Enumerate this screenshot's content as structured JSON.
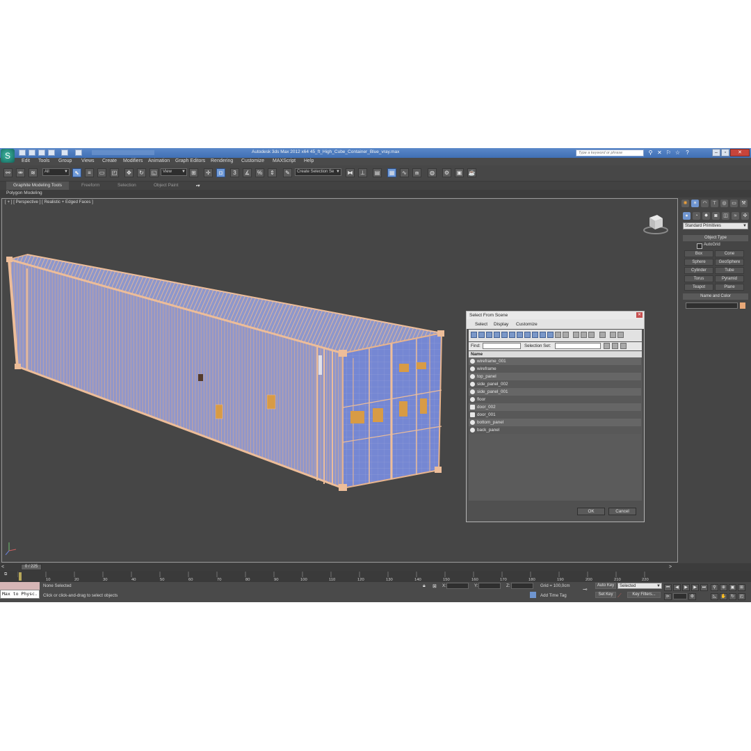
{
  "app": {
    "title": "Autodesk 3ds Max  2012 x64      45_ft_High_Cube_Container_Blue_vray.max",
    "search_placeholder": "Type a keyword or phrase"
  },
  "menu": [
    "Edit",
    "Tools",
    "Group",
    "Views",
    "Create",
    "Modifiers",
    "Animation",
    "Graph Editors",
    "Rendering",
    "Customize",
    "MAXScript",
    "Help"
  ],
  "toolbar": {
    "selection_filter": "All",
    "reference_coord": "View",
    "named_selection": "Create Selection Se"
  },
  "ribbon": {
    "tabs": [
      "Graphite Modeling Tools",
      "Freeform",
      "Selection",
      "Object Paint"
    ],
    "active_tab": "Graphite Modeling Tools",
    "subpanel": "Polygon Modeling"
  },
  "viewport": {
    "label": "[ + ] [ Perspective ] [ Realistic + Edged Faces ]"
  },
  "command_panel": {
    "category": "Standard Primitives",
    "object_type_title": "Object Type",
    "autogrid": "AutoGrid",
    "buttons": [
      "Box",
      "Cone",
      "Sphere",
      "GeoSphere",
      "Cylinder",
      "Tube",
      "Torus",
      "Pyramid",
      "Teapot",
      "Plane"
    ],
    "name_color_title": "Name and Color",
    "color": "#e8a878"
  },
  "dialog": {
    "title": "Select From Scene",
    "menu": [
      "Select",
      "Display",
      "Customize"
    ],
    "find_label": "Find:",
    "selection_set_label": "Selection Set:",
    "column_header": "Name",
    "items": [
      "wireframe_001",
      "wireframe",
      "top_panel",
      "side_panel_002",
      "side_panel_001",
      "floor",
      "door_002",
      "door_001",
      "bottom_panel",
      "back_panel"
    ],
    "ok": "OK",
    "cancel": "Cancel"
  },
  "timeline": {
    "position": "0 / 225",
    "ticks": [
      "10",
      "20",
      "30",
      "40",
      "50",
      "60",
      "70",
      "80",
      "90",
      "100",
      "110",
      "120",
      "130",
      "140",
      "150",
      "160",
      "170",
      "180",
      "190",
      "200",
      "210",
      "220"
    ]
  },
  "status": {
    "max_to_physc": "Max to Physc.",
    "none_selected": "None Selected",
    "prompt": "Click or click-and-drag to select objects",
    "x_label": "X:",
    "y_label": "Y:",
    "z_label": "Z:",
    "grid": "Grid = 100,0cm",
    "add_time_tag": "Add Time Tag",
    "auto_key": "Auto Key",
    "set_key": "Set Key",
    "selected": "Selected",
    "key_filters": "Key Filters..."
  },
  "colors": {
    "container_fill": "#7e8fce",
    "wire_edges": "#e7b48e",
    "viewport_bg": "#464646",
    "title_bar": "#4a7bbf"
  }
}
